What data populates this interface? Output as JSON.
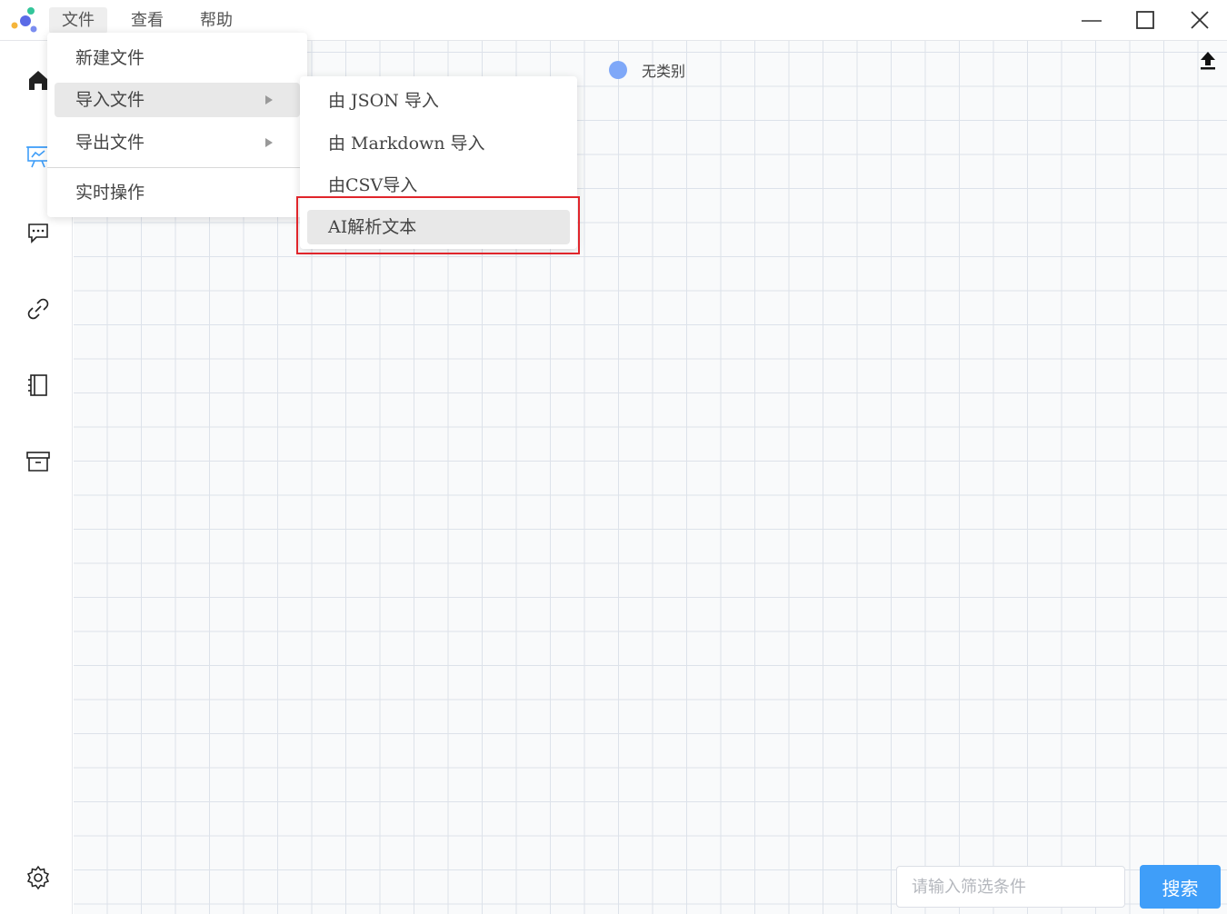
{
  "menubar": {
    "items": [
      {
        "label": "文件"
      },
      {
        "label": "查看"
      },
      {
        "label": "帮助"
      }
    ]
  },
  "file_menu": {
    "items": [
      {
        "label": "新建文件"
      },
      {
        "label": "导入文件"
      },
      {
        "label": "导出文件"
      },
      {
        "label": "实时操作"
      }
    ]
  },
  "import_menu": {
    "items": [
      {
        "label": "由 JSON 导入"
      },
      {
        "label": "由 Markdown 导入"
      },
      {
        "label": "由CSV导入"
      },
      {
        "label": "AI解析文本"
      }
    ]
  },
  "canvas": {
    "legend": {
      "label": "无类别",
      "color": "#7fa8f8"
    }
  },
  "sidebar": {
    "icons": [
      "home-icon",
      "presentation-icon",
      "message-icon",
      "link-icon",
      "notebook-icon",
      "archive-icon",
      "settings-icon"
    ],
    "active": "presentation-icon",
    "active_color": "#3f9ef9"
  },
  "search": {
    "placeholder": "请输入筛选条件",
    "button_label": "搜索"
  },
  "colors": {
    "accent": "#3f9ef9",
    "highlight": "#e0252b"
  }
}
